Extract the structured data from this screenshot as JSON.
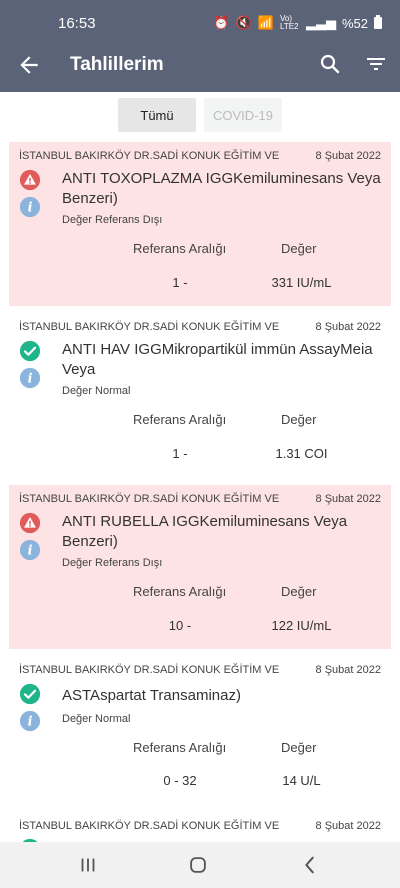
{
  "status_bar": {
    "time": "16:53",
    "network": "Vo) LTE2",
    "battery": "%52"
  },
  "app_bar": {
    "title": "Tahlillerim"
  },
  "tabs": [
    {
      "label": "Tümü"
    },
    {
      "label": "COVID-19"
    }
  ],
  "table_headers": {
    "reference": "Referans Aralığı",
    "value": "Değer"
  },
  "results": [
    {
      "hospital": "İSTANBUL BAKIRKÖY DR.SADİ KONUK EĞİTİM VE",
      "date": "8 Şubat 2022",
      "name": "ANTI TOXOPLAZMA IGGKemiluminesans Veya Benzeri)",
      "status": "Değer Referans Dışı",
      "reference": "1 -",
      "value": "331 IU/mL"
    },
    {
      "hospital": "İSTANBUL BAKIRKÖY DR.SADİ KONUK EĞİTİM VE",
      "date": "8 Şubat 2022",
      "name": "ANTI HAV IGGMikropartikül immün AssayMeia Veya",
      "status": "Değer Normal",
      "reference": "1 -",
      "value": "1.31 COI"
    },
    {
      "hospital": "İSTANBUL BAKIRKÖY DR.SADİ KONUK EĞİTİM VE",
      "date": "8 Şubat 2022",
      "name": "ANTI RUBELLA IGGKemiluminesans Veya Benzeri)",
      "status": "Değer Referans Dışı",
      "reference": "10 -",
      "value": "122 IU/mL"
    },
    {
      "hospital": "İSTANBUL BAKIRKÖY DR.SADİ KONUK EĞİTİM VE",
      "date": "8 Şubat 2022",
      "name": "ASTAspartat Transaminaz)",
      "status": "Değer Normal",
      "reference": "0 - 32",
      "value": "14 U/L"
    },
    {
      "hospital": "İSTANBUL BAKIRKÖY DR.SADİ KONUK EĞİTİM VE",
      "date": "8 Şubat 2022"
    }
  ],
  "colors": {
    "header": "#5b6378",
    "alert_bg": "#fde3e3",
    "alert_icon": "#e15b5b",
    "ok_icon": "#1fb58a",
    "info_icon": "#8ab4dc"
  }
}
